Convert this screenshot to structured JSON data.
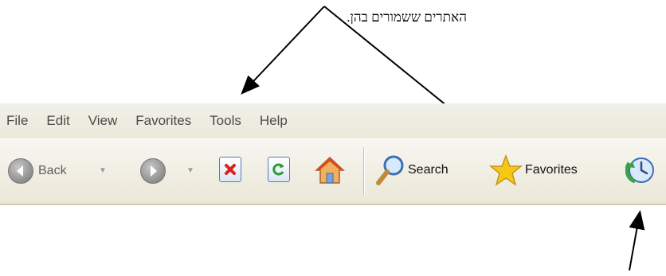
{
  "caption": {
    "text": "האתרים ששמורים בהן."
  },
  "menubar": {
    "items": [
      "File",
      "Edit",
      "View",
      "Favorites",
      "Tools",
      "Help"
    ]
  },
  "toolbar": {
    "back_label": "Back",
    "search_label": "Search",
    "favorites_label": "Favorites"
  },
  "icons": {
    "back": "back-arrow-icon",
    "forward": "forward-arrow-icon",
    "stop": "stop-icon",
    "refresh": "refresh-icon",
    "home": "home-icon",
    "search": "magnifier-icon",
    "favorites": "star-icon",
    "history": "history-clock-icon"
  },
  "colors": {
    "toolbar_bg": "#ece9d8",
    "stop_red": "#d8231c",
    "refresh_green": "#2a9a36",
    "star_yellow": "#f5c816",
    "history_green": "#3aa14a"
  }
}
